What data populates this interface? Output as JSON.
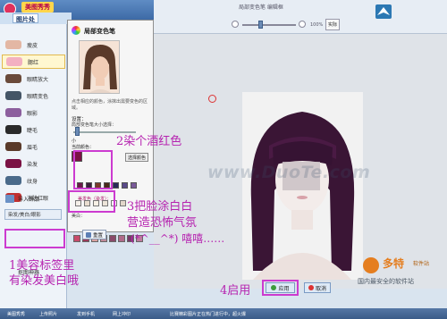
{
  "app": {
    "title": "美图秀秀",
    "tab": "图片处"
  },
  "sidebar": {
    "items": [
      {
        "label": "瘦皮",
        "color": "#e3b7a4"
      },
      {
        "label": "腮红",
        "color": "#f3b0c1"
      },
      {
        "label": "眼睛放大",
        "color": "#6a4a3a"
      },
      {
        "label": "眼睛变色",
        "color": "#445566"
      },
      {
        "label": "眼影",
        "color": "#8c5f9e"
      },
      {
        "label": "睫毛",
        "color": "#2a2a2a"
      },
      {
        "label": "眉毛",
        "color": "#5a3a2a"
      },
      {
        "label": "染发",
        "color": "#7a1244"
      },
      {
        "label": "纹身",
        "color": "#4a6a8a"
      },
      {
        "label": "消除红眼",
        "color": "#c03030"
      }
    ],
    "import_label": "导入饰品",
    "tag_label": "染发/美白/眼影",
    "footer": "抠图神器"
  },
  "tool_panel": {
    "title": "局部变色笔",
    "desc": "点击相应的颜色，涂抹出需要变色的区域。",
    "settings_label": "设置：",
    "brush_size_label": "局部变色笔大小选择：",
    "brush_min": "小",
    "current_color_label": "当前颜色：",
    "choose_button": "选择颜色",
    "dye_label": "美发色（染发）：",
    "whiten_label": "美白：",
    "reset_button": "重置",
    "dye_colors": [
      "#6a1a4a",
      "#3a1e3a",
      "#7a3a2a",
      "#4a2a1a",
      "#2a2a5a",
      "#5a4a8a",
      "#7a5a9a"
    ],
    "white_colors": [
      "#f4efe9",
      "#e9ddd0",
      "#f7f0e6",
      "#ece4d9",
      "#ffffff",
      "#e2d7ca"
    ],
    "color_blocks": [
      "#c74b6a",
      "#9a3a5a",
      "#d9a0a0",
      "#c08a9a",
      "#8a4a6a",
      "#b06a8a",
      "#7a3a6a",
      "#c07aa0"
    ]
  },
  "editor": {
    "title": "局部变色笔 编辑框",
    "zoom_percent": "100%",
    "zoom_level": 0.33,
    "real_size_label": "实际"
  },
  "brush": {
    "size_level": 0.05
  },
  "buttons": {
    "apply": "应用",
    "cancel": "取消"
  },
  "watermark": "www.DuoTe.com",
  "brand": {
    "name": "多特",
    "sub": "软件站",
    "slogan": "国内最安全的软件站"
  },
  "statusbar": {
    "item1": "美图秀秀",
    "item2": "上传照片",
    "item3": "发到手机",
    "item4": "网上冲印",
    "news": "比赛精彩图片正在热门进行中，超火爆"
  },
  "annotations": {
    "a1_line1": "1美容标签里",
    "a1_line2": "有染发美白哦",
    "a2": "2染个酒红色",
    "a3_line1": "3把脸涂白白",
    "a3_line2": "营造恐怖气氛",
    "a3_line3": "(*^__^*) 嘻嘻……",
    "a4": "4启用"
  }
}
